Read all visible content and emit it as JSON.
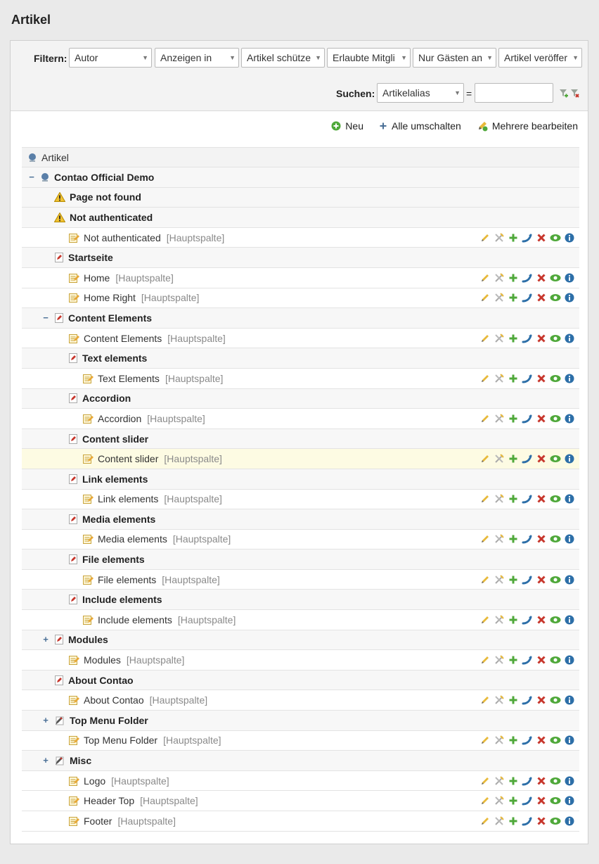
{
  "page": {
    "title": "Artikel"
  },
  "filters": {
    "label": "Filtern:",
    "selects": [
      "Autor",
      "Anzeigen in",
      "Artikel schütze",
      "Erlaubte Mitgli",
      "Nur Gästen an",
      "Artikel veröffer"
    ]
  },
  "search": {
    "label": "Suchen:",
    "field": "Artikelalias",
    "operator": "=",
    "value": ""
  },
  "actions": {
    "new": "Neu",
    "toggle_all": "Alle umschalten",
    "edit_multiple": "Mehrere bearbeiten"
  },
  "tree": {
    "root_label": "Artikel",
    "rows": [
      {
        "type": "site",
        "label": "Contao Official Demo",
        "toggle": "−"
      },
      {
        "type": "page",
        "label": "Page not found",
        "icon": "warning-icon"
      },
      {
        "type": "page",
        "label": "Not authenticated",
        "icon": "warning-icon"
      },
      {
        "type": "article",
        "label": "Not authenticated",
        "column": "[Hauptspalte]"
      },
      {
        "type": "page",
        "label": "Startseite",
        "icon": "page-icon"
      },
      {
        "type": "article",
        "label": "Home",
        "column": "[Hauptspalte]"
      },
      {
        "type": "article",
        "label": "Home Right",
        "column": "[Hauptspalte]"
      },
      {
        "type": "page",
        "label": "Content Elements",
        "icon": "page-icon",
        "toggle": "−"
      },
      {
        "type": "article",
        "label": "Content Elements",
        "column": "[Hauptspalte]"
      },
      {
        "type": "subpage",
        "label": "Text elements",
        "icon": "page-icon"
      },
      {
        "type": "subarticle",
        "label": "Text Elements",
        "column": "[Hauptspalte]"
      },
      {
        "type": "subpage",
        "label": "Accordion",
        "icon": "page-icon"
      },
      {
        "type": "subarticle",
        "label": "Accordion",
        "column": "[Hauptspalte]"
      },
      {
        "type": "subpage",
        "label": "Content slider",
        "icon": "page-icon"
      },
      {
        "type": "subarticle",
        "label": "Content slider",
        "column": "[Hauptspalte]",
        "highlight": true
      },
      {
        "type": "subpage",
        "label": "Link elements",
        "icon": "page-icon"
      },
      {
        "type": "subarticle",
        "label": "Link elements",
        "column": "[Hauptspalte]"
      },
      {
        "type": "subpage",
        "label": "Media elements",
        "icon": "page-icon"
      },
      {
        "type": "subarticle",
        "label": "Media elements",
        "column": "[Hauptspalte]"
      },
      {
        "type": "subpage",
        "label": "File elements",
        "icon": "page-icon"
      },
      {
        "type": "subarticle",
        "label": "File elements",
        "column": "[Hauptspalte]"
      },
      {
        "type": "subpage",
        "label": "Include elements",
        "icon": "page-icon"
      },
      {
        "type": "subarticle",
        "label": "Include elements",
        "column": "[Hauptspalte]"
      },
      {
        "type": "page",
        "label": "Modules",
        "icon": "page-icon",
        "toggle": "+"
      },
      {
        "type": "article",
        "label": "Modules",
        "column": "[Hauptspalte]"
      },
      {
        "type": "page",
        "label": "About Contao",
        "icon": "page-icon"
      },
      {
        "type": "article",
        "label": "About Contao",
        "column": "[Hauptspalte]"
      },
      {
        "type": "page",
        "label": "Top Menu Folder",
        "icon": "folder-page-icon",
        "toggle": "+"
      },
      {
        "type": "article",
        "label": "Top Menu Folder",
        "column": "[Hauptspalte]"
      },
      {
        "type": "page",
        "label": "Misc",
        "icon": "folder-page-icon",
        "toggle": "+"
      },
      {
        "type": "article",
        "label": "Logo",
        "column": "[Hauptspalte]"
      },
      {
        "type": "article",
        "label": "Header Top",
        "column": "[Hauptspalte]"
      },
      {
        "type": "article",
        "label": "Footer",
        "column": "[Hauptspalte]"
      }
    ]
  },
  "row_operations": [
    "edit-icon",
    "edit-header-icon",
    "copy-icon",
    "cut-icon",
    "delete-icon",
    "toggle-visibility-icon",
    "info-icon"
  ],
  "colors": {
    "accent_green": "#4fa83a",
    "delete_red": "#c7362c",
    "info_blue": "#2d6fa8",
    "highlight": "#fdfbe3"
  }
}
